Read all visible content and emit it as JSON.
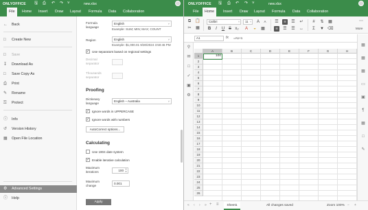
{
  "app": {
    "brand": "ONLYOFFICE",
    "filename": "new.xlsx",
    "accent": "#3b8c4a",
    "left_tabs": [
      "File",
      "Home",
      "Insert",
      "Draw",
      "Layout",
      "Formula",
      "Data",
      "Collaboration"
    ],
    "right_tabs": [
      "File",
      "Home",
      "Insert",
      "Draw",
      "Layout",
      "Formula",
      "Data",
      "Collaboration"
    ]
  },
  "filemenu": {
    "items": [
      {
        "label": "Back",
        "icon": "arrow-left-icon"
      },
      {
        "label": "Create New",
        "icon": "new-file-icon"
      },
      {
        "label": "Save",
        "icon": "save-icon",
        "disabled": true
      },
      {
        "label": "Download As",
        "icon": "download-icon"
      },
      {
        "label": "Save Copy As",
        "icon": "save-copy-icon"
      },
      {
        "label": "Print",
        "icon": "print-icon"
      },
      {
        "label": "Rename",
        "icon": "rename-icon"
      },
      {
        "label": "Protect",
        "icon": "protect-icon"
      },
      {
        "label": "Info",
        "icon": "info-icon"
      },
      {
        "label": "Version History",
        "icon": "history-icon"
      },
      {
        "label": "Open File Location",
        "icon": "folder-icon"
      },
      {
        "label": "Advanced Settings",
        "icon": "settings-icon",
        "selected": true
      },
      {
        "label": "Help",
        "icon": "help-icon"
      }
    ]
  },
  "settings": {
    "formula_language_label": "Formula language",
    "formula_language_value": "English",
    "formula_example": "Example: SUM; MIN; MAX; COUNT",
    "region_label": "Region",
    "region_value": "English",
    "region_example": "Example: $1,000.01 9/30/2024 3:50:46 PM",
    "use_separators_label": "Use separators based on regional settings",
    "use_separators_checked": true,
    "decimal_separator_label": "Decimal separator",
    "thousands_separator_label": "Thousands separator",
    "proofing_heading": "Proofing",
    "dictionary_language_label": "Dictionary language",
    "dictionary_language_value": "English – Australia",
    "ignore_uppercase_label": "Ignore words in UPPERCASE",
    "ignore_uppercase_checked": true,
    "ignore_numbers_label": "Ignore words with numbers",
    "ignore_numbers_checked": true,
    "autocorrect_button": "AutoCorrect options...",
    "calculating_heading": "Calculating",
    "date1904_label": "Use 1904 date system",
    "date1904_checked": false,
    "iterative_label": "Enable iterative calculation",
    "iterative_checked": true,
    "max_iterations_label": "Maximum iterations",
    "max_iterations_value": "100",
    "max_change_label": "Maximum change",
    "max_change_value": "0.001",
    "apply_button": "Apply"
  },
  "toolbar": {
    "font_name": "Calibri",
    "font_size": "11",
    "more_label": "More"
  },
  "formula_bar": {
    "cell_ref": "A1",
    "fx_label": "fx",
    "formula": "=A1+1"
  },
  "grid": {
    "columns": [
      "A",
      "B",
      "C",
      "D",
      "E",
      "F",
      "G",
      "H"
    ],
    "rows": [
      "1",
      "2",
      "3",
      "4",
      "5",
      "6",
      "7",
      "8",
      "9",
      "10",
      "11",
      "12",
      "13",
      "14",
      "15",
      "16",
      "17",
      "18",
      "19",
      "20",
      "21",
      "22",
      "23",
      "24",
      "25",
      "26"
    ],
    "active_cell_value": "100"
  },
  "statusbar": {
    "sheet_name": "Sheet1",
    "save_status": "All changes saved",
    "zoom": "Zoom 100%"
  }
}
